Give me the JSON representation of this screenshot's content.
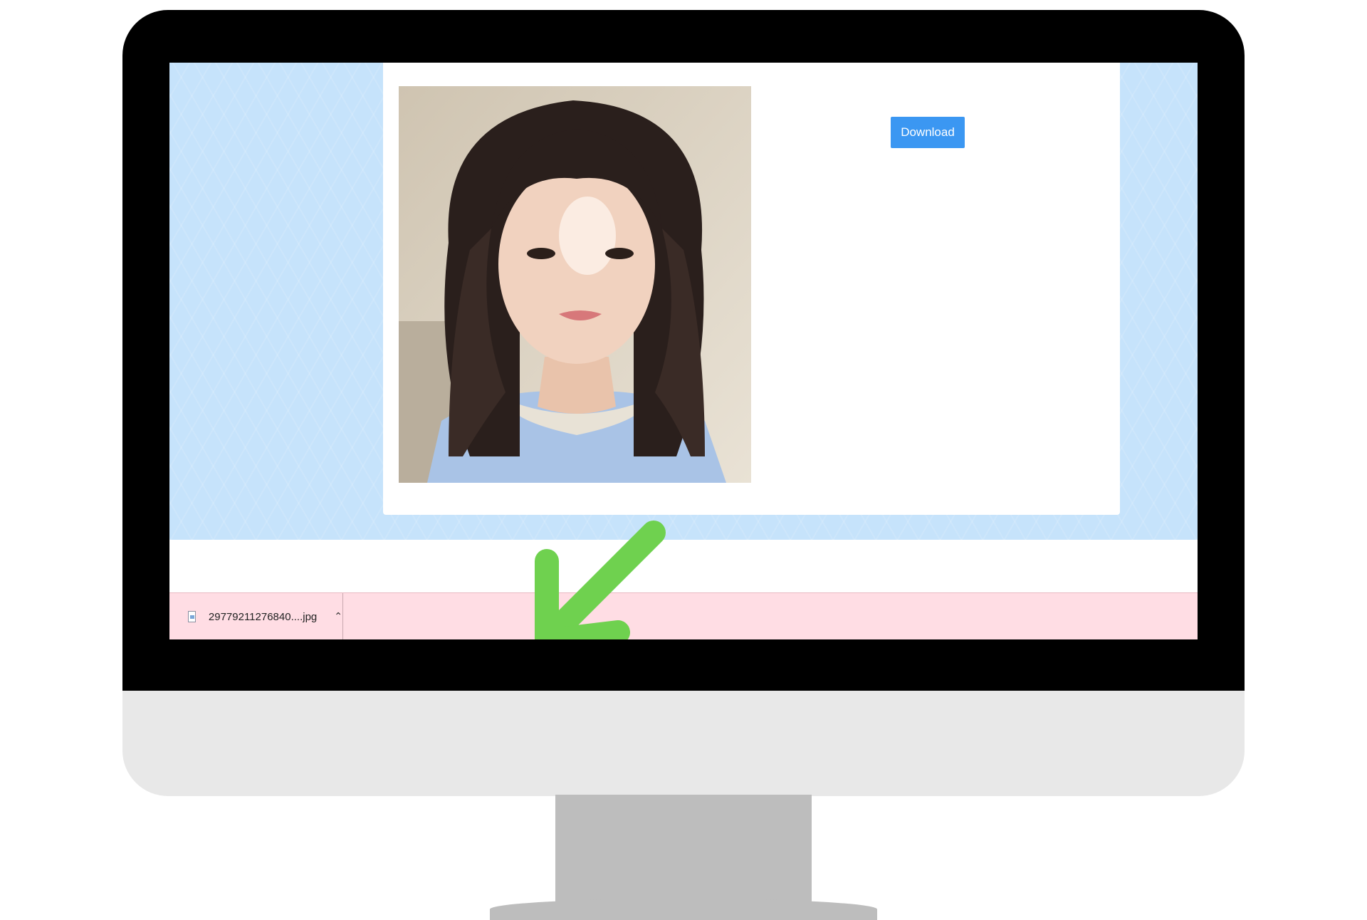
{
  "viewer": {
    "download_label": "Download",
    "image": {
      "description_icon": "portrait-photo"
    }
  },
  "downloads_bar": {
    "items": [
      {
        "file_name": "29779211276840....jpg",
        "icon": "file-image-icon",
        "menu_icon": "chevron-up-icon"
      }
    ]
  },
  "annotation": {
    "icon": "arrow-pointing-down-left",
    "color": "#6fd14f"
  },
  "colors": {
    "page_background": "#c6e3fb",
    "button": "#3b97f2",
    "downloads_bar": "#ffdde4",
    "bezel": "#000000",
    "chin": "#e8e8e8",
    "stand": "#bdbdbd"
  }
}
